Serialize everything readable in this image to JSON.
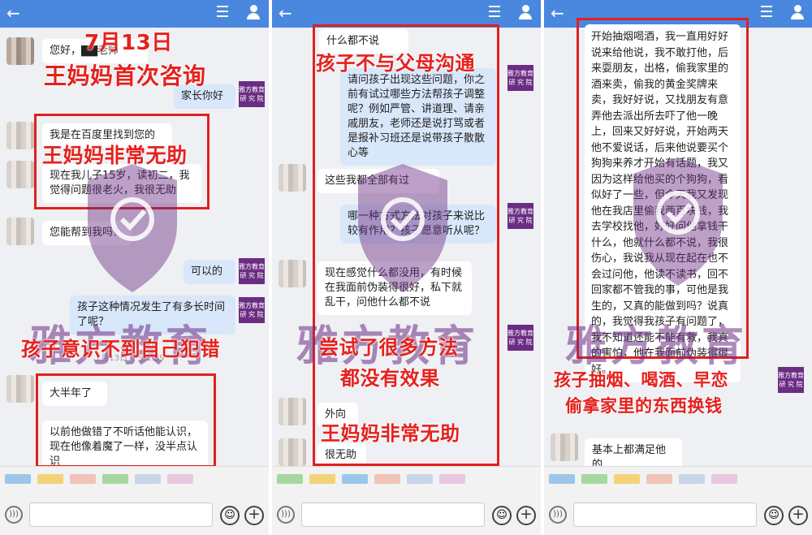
{
  "icons": {
    "back": "arrow-left-icon",
    "menu": "menu-icon",
    "user": "user-icon",
    "emoji": "emoji-icon",
    "plus": "plus-icon",
    "voice": "voice-icon",
    "shield": "shield-check-icon"
  },
  "colors": {
    "topbar": "#4a87de",
    "annotation": "#e5211d",
    "watermark": "#6b2c83",
    "badge": "#6b2c83"
  },
  "watermark": "雅方教育",
  "badge": {
    "line1": "雅方教育",
    "line2": "研 究 院"
  },
  "panel1": {
    "annotations": {
      "date": "7月13日",
      "first": "王妈妈首次咨询",
      "helpless": "王妈妈非常无助",
      "unaware": "孩子意识不到自己犯错"
    },
    "messages": {
      "m1": "您好，▇▇老师",
      "m2": "家长你好",
      "m3": "我是在百度里找到您的",
      "m4": "现在我儿子15岁，读初二，我觉得问题很老火，我很无助",
      "m5": "您能帮到我吗？",
      "m6": "可以的",
      "m7": "孩子这种情况发生了有多长时间了呢？",
      "m8": "大半年了",
      "m9": "以前他做错了不听话他能认识，现在他像着魔了一样，没半点认识"
    },
    "timestamp": "7月13日 下午1:59"
  },
  "panel2": {
    "annotations": {
      "no_comm": "孩子不与父母沟通",
      "tried1": "尝试了很多方法",
      "tried2": "都没有效果",
      "helpless": "王妈妈非常无助"
    },
    "messages": {
      "m1": "什么都不说",
      "m2": "请问孩子出现这些问题，你之前有试过哪些方法帮孩子调整呢？例如严管、讲道理、请亲戚朋友，老师还是说打骂或者是报补习班还是说带孩子散散心等",
      "m3": "这些我都全部有过",
      "m4": "哪一种方式方法对孩子来说比较有作用？孩子愿意听从呢？",
      "m5": "现在感觉什么都没用，有时候在我面前伪装得很好，私下就乱干，问他什么都不说",
      "m6": "外向",
      "m7": "很无助"
    }
  },
  "panel3": {
    "annotations": {
      "line1": "孩子抽烟、喝酒、早恋",
      "line2": "偷拿家里的东西换钱"
    },
    "messages": {
      "m1": "开始抽烟喝酒，我一直用好好说来给他说，我不敢打他，后来耍朋友，出格，偷我家里的酒来卖，偷我的黄金奖牌来卖，我好好说，又找朋友有意弄他去派出所去吓了他一晚上，回来又好好说，开始两天他不爱说话，后来他说要买个狗狗来养才开始有话题，我又因为这样给他买的个狗狗，看似好了一些，但今天我又发现他在我店里偷我两百块钱，我去学校找他，好好问他拿钱干什么，他就什么都不说，我很伤心，我说我从现在起在也不会过问他，他读不读书，回不回家都不管我的事，可他是我生的，又真的能做到吗？说真的，我觉得我孩子有问题了，我不知道还能不能有救，我真的害怕，他在我面前伪装得很好。",
      "m2": "基本上都满足他的"
    }
  }
}
